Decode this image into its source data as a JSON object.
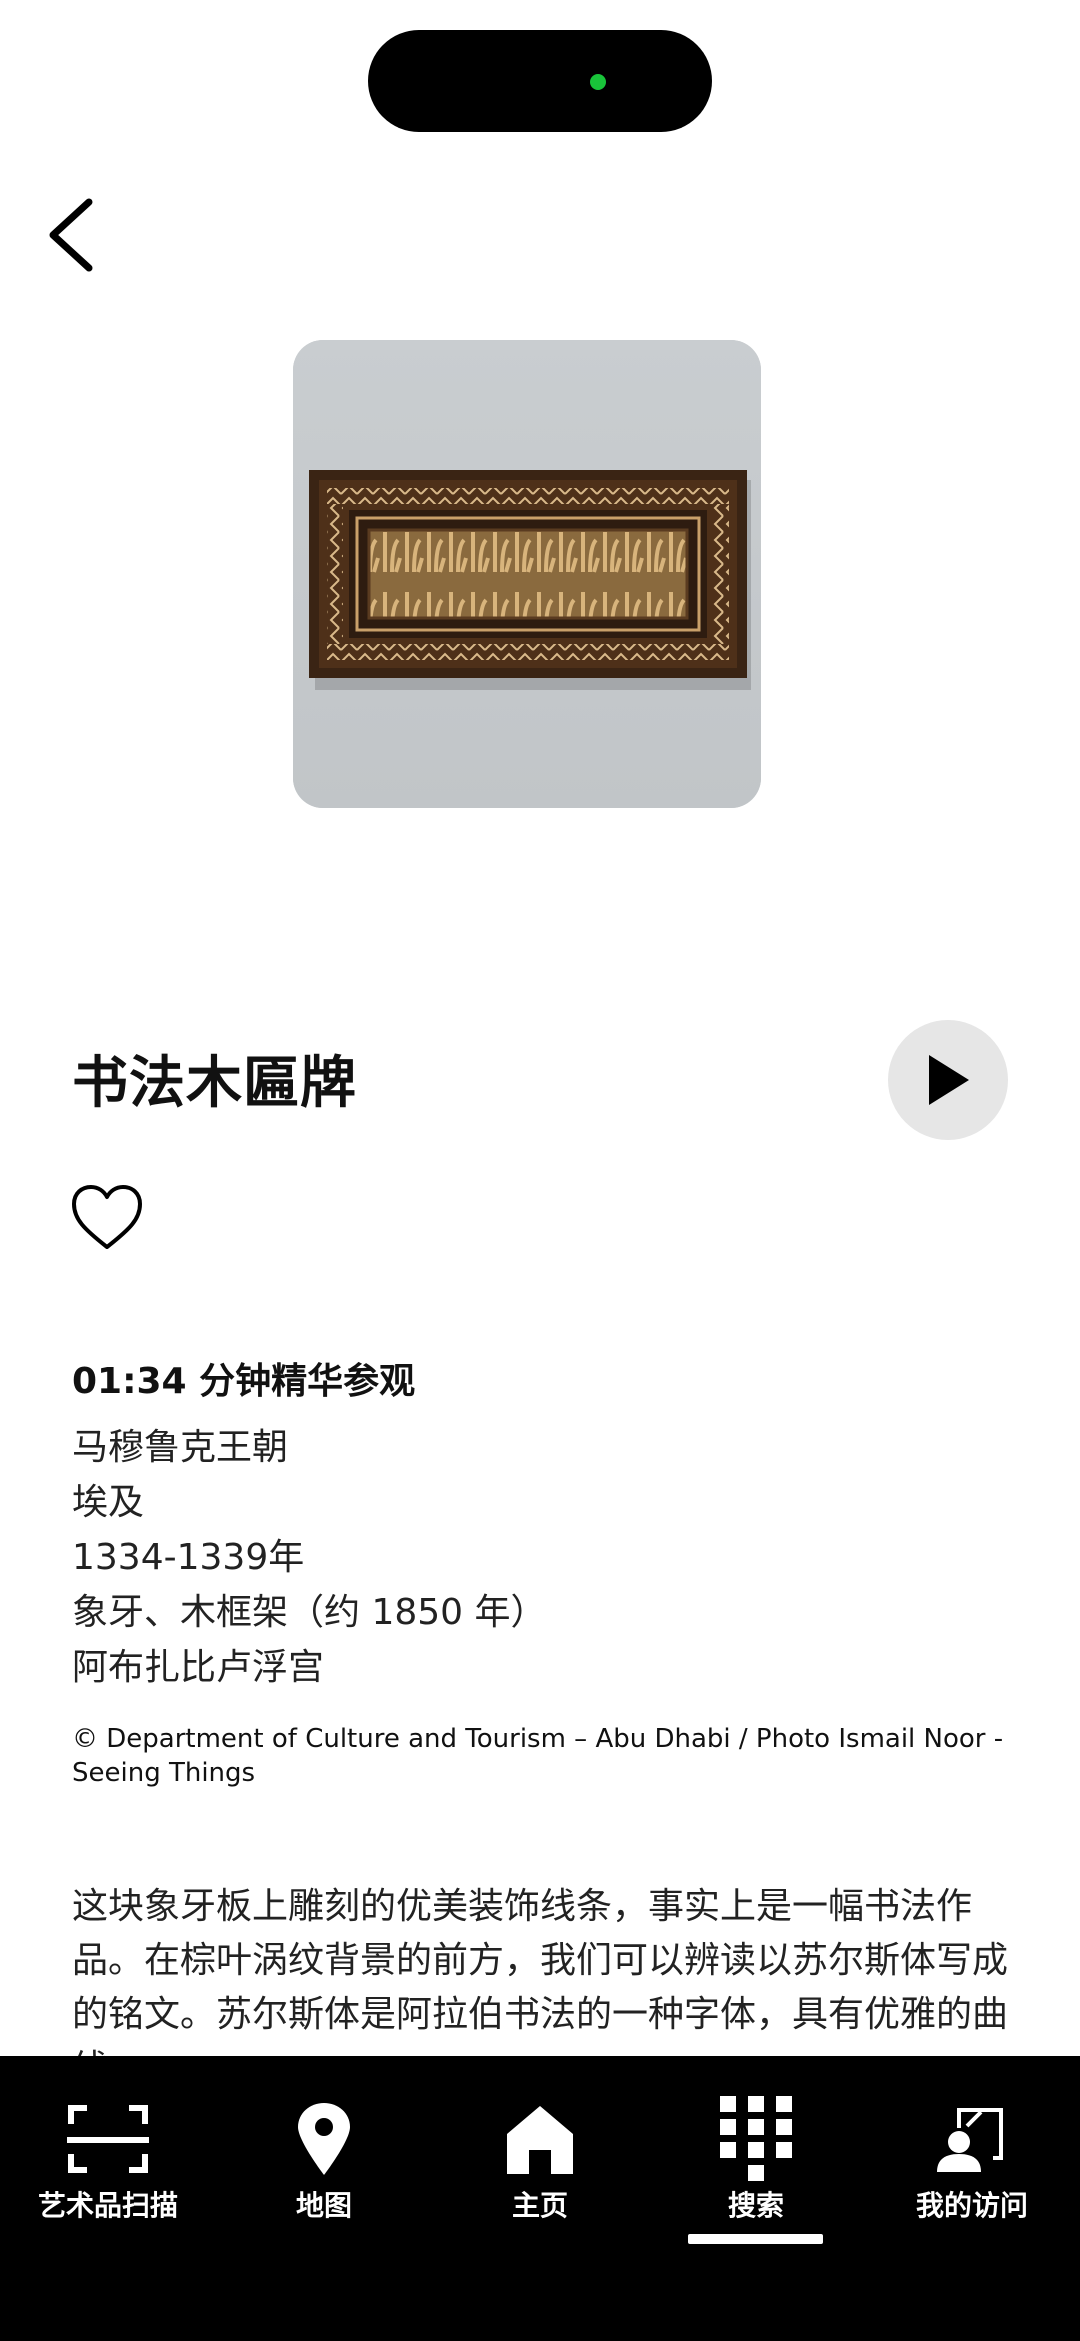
{
  "artwork": {
    "title": "书法木匾牌",
    "image_alt": "雕刻书法木匾牌"
  },
  "audio": {
    "duration_label": "01:34 分钟精华参观"
  },
  "meta_lines": [
    "马穆鲁克王朝",
    "埃及",
    "1334-1339年",
    "象牙、木框架（约 1850 年）",
    "阿布扎比卢浮宫"
  ],
  "credit": "© Department of Culture and Tourism – Abu Dhabi / Photo Ismail Noor - Seeing Things",
  "description": "这块象牙板上雕刻的优美装饰线条，事实上是一幅书法作品。在棕叶涡纹背景的前方，我们可以辨读以苏尔斯体写成的铭文。苏尔斯体是阿拉伯书法的一种字体，具有优雅的曲线",
  "tabs": [
    {
      "label": "艺术品扫描",
      "icon": "scan-icon"
    },
    {
      "label": "地图",
      "icon": "map-pin-icon"
    },
    {
      "label": "主页",
      "icon": "home-icon"
    },
    {
      "label": "搜索",
      "icon": "keypad-icon",
      "active": true
    },
    {
      "label": "我的访问",
      "icon": "visitor-icon"
    }
  ],
  "colors": {
    "tabbar_bg": "#000000",
    "play_button_bg": "#e6e6e6",
    "status_dot": "#19c43a"
  }
}
